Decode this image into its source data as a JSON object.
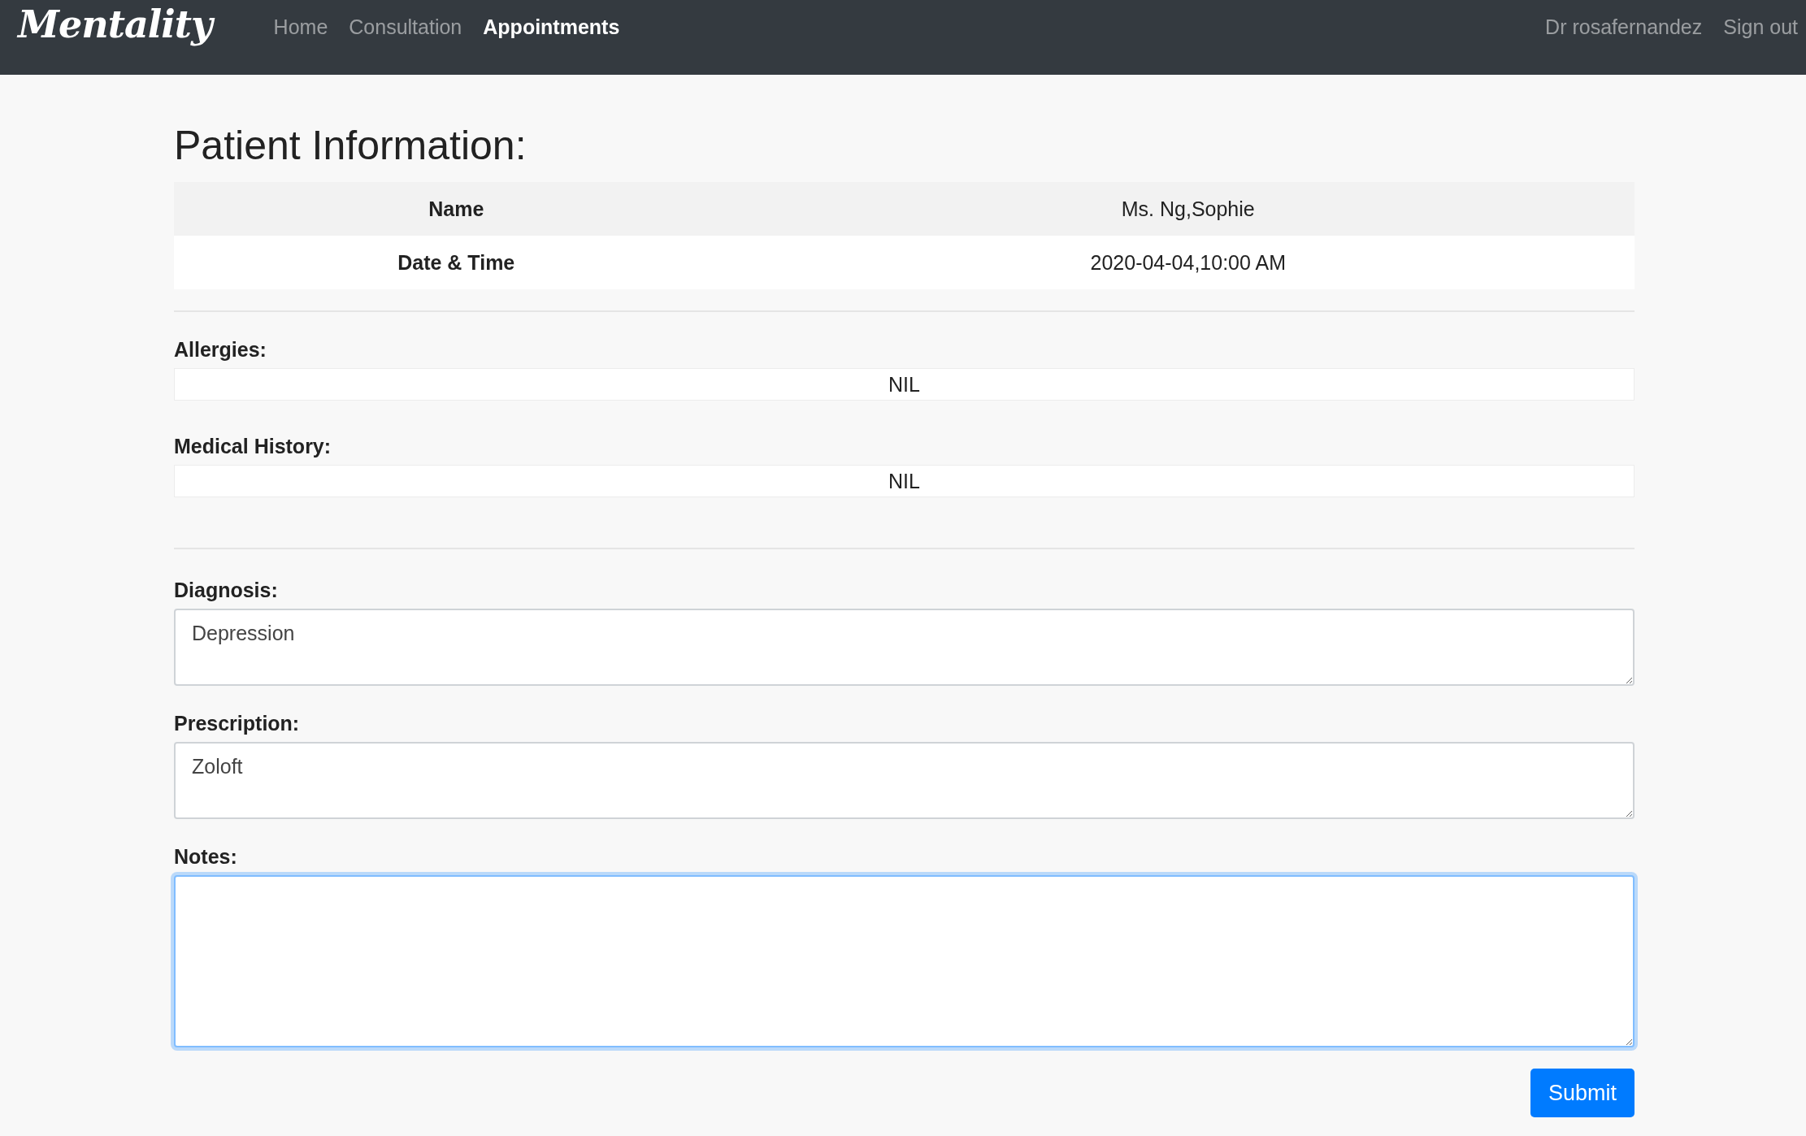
{
  "nav": {
    "brand": "Mentality",
    "links": [
      {
        "label": "Home",
        "selected": false
      },
      {
        "label": "Consultation",
        "selected": false
      },
      {
        "label": "Appointments",
        "selected": true
      }
    ],
    "user": "Dr rosafernandez",
    "signout": "Sign out"
  },
  "title": "Patient Information:",
  "info_table": {
    "rows": [
      {
        "label": "Name",
        "value": "Ms. Ng,Sophie"
      },
      {
        "label": "Date & Time",
        "value": "2020-04-04,10:00 AM"
      }
    ]
  },
  "readonly_fields": [
    {
      "label": "Allergies:",
      "value": "NIL"
    },
    {
      "label": "Medical History:",
      "value": "NIL"
    }
  ],
  "text_areas": [
    {
      "label": "Diagnosis:",
      "value": "Depression",
      "focused": false
    },
    {
      "label": "Prescription:",
      "value": "Zoloft",
      "focused": false
    },
    {
      "label": "Notes:",
      "focused": true
    }
  ],
  "submit": "Submit"
}
